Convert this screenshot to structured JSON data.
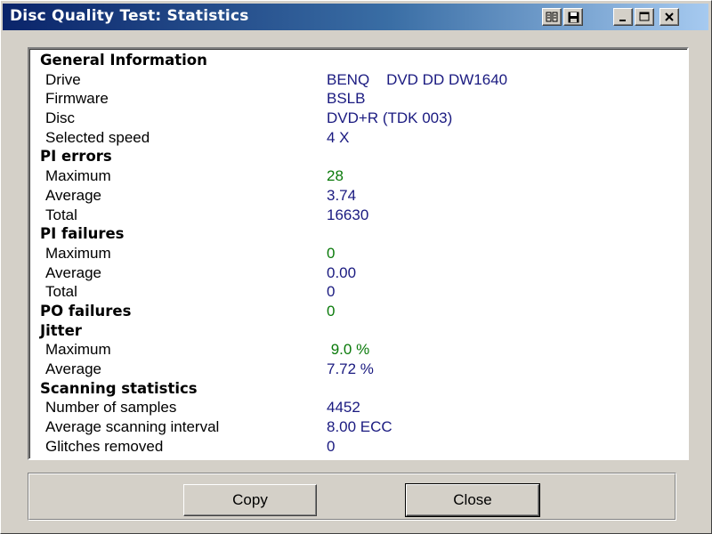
{
  "window": {
    "title": "Disc Quality Test: Statistics"
  },
  "title_buttons": {
    "icon1": "book-icon",
    "icon2": "save-icon",
    "minimize": "minimize-icon",
    "maximize": "maximize-icon",
    "close": "close-icon"
  },
  "stats": {
    "general": {
      "heading": "General Information",
      "drive_label": "Drive",
      "drive_value": "BENQ    DVD DD DW1640",
      "firmware_label": "Firmware",
      "firmware_value": "BSLB",
      "disc_label": "Disc",
      "disc_value": "DVD+R (TDK 003)",
      "speed_label": "Selected speed",
      "speed_value": "4 X"
    },
    "pi_errors": {
      "heading": "PI errors",
      "max_label": "Maximum",
      "max_value": "28",
      "avg_label": "Average",
      "avg_value": "3.74",
      "total_label": "Total",
      "total_value": "16630"
    },
    "pi_failures": {
      "heading": "PI failures",
      "max_label": "Maximum",
      "max_value": "0",
      "avg_label": "Average",
      "avg_value": "0.00",
      "total_label": "Total",
      "total_value": "0"
    },
    "po_failures": {
      "heading": "PO failures",
      "value": "0"
    },
    "jitter": {
      "heading": "Jitter",
      "max_label": "Maximum",
      "max_value": " 9.0 %",
      "avg_label": "Average",
      "avg_value": "7.72 %"
    },
    "scanning": {
      "heading": "Scanning statistics",
      "samples_label": "Number of samples",
      "samples_value": "4452",
      "interval_label": "Average scanning interval",
      "interval_value": "8.00 ECC",
      "glitches_label": "Glitches removed",
      "glitches_value": "0"
    }
  },
  "buttons": {
    "copy": "Copy",
    "close": "Close"
  },
  "colors": {
    "title_start": "#0a246a",
    "title_end": "#a6caf0",
    "value_blue": "#1a1a80",
    "value_green": "#0a7a0a",
    "face": "#d4d0c8"
  }
}
